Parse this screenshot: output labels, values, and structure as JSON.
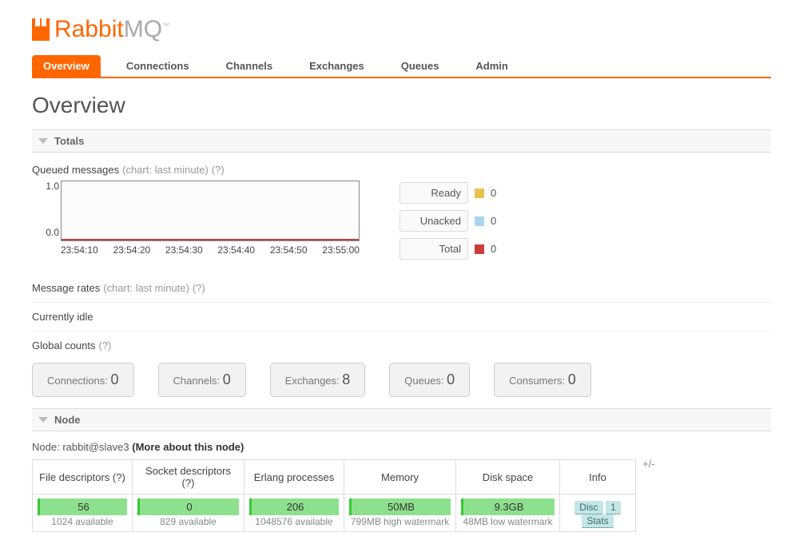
{
  "brand": {
    "name_a": "Rabbit",
    "name_b": "MQ"
  },
  "tabs": [
    "Overview",
    "Connections",
    "Channels",
    "Exchanges",
    "Queues",
    "Admin"
  ],
  "active_tab": 0,
  "page_title": "Overview",
  "sections": {
    "totals": "Totals",
    "node": "Node"
  },
  "queued": {
    "label": "Queued messages",
    "chart_hint": "(chart: last minute)",
    "help": "(?)"
  },
  "message_rates": {
    "label": "Message rates",
    "chart_hint": "(chart: last minute)",
    "help": "(?)",
    "status": "Currently idle"
  },
  "global_counts_label": "Global counts",
  "global_counts_help": "(?)",
  "chart_data": {
    "type": "line",
    "title": "Queued messages",
    "xlabel": "",
    "ylabel": "",
    "ylim": [
      0.0,
      1.0
    ],
    "y_ticks": [
      "1.0",
      "0.0"
    ],
    "x_ticks": [
      "23:54:10",
      "23:54:20",
      "23:54:30",
      "23:54:40",
      "23:54:50",
      "23:55:00"
    ],
    "series": [
      {
        "name": "Ready",
        "color": "#e6c24d",
        "values": [
          0,
          0,
          0,
          0,
          0,
          0
        ],
        "current": 0
      },
      {
        "name": "Unacked",
        "color": "#a8d6f0",
        "values": [
          0,
          0,
          0,
          0,
          0,
          0
        ],
        "current": 0
      },
      {
        "name": "Total",
        "color": "#cc3b3b",
        "values": [
          0,
          0,
          0,
          0,
          0,
          0
        ],
        "current": 0
      }
    ]
  },
  "counts": [
    {
      "label": "Connections:",
      "value": "0"
    },
    {
      "label": "Channels:",
      "value": "0"
    },
    {
      "label": "Exchanges:",
      "value": "8"
    },
    {
      "label": "Queues:",
      "value": "0"
    },
    {
      "label": "Consumers:",
      "value": "0"
    }
  ],
  "node": {
    "prefix": "Node:",
    "name": "rabbit@slave3",
    "more": "(More about this node)",
    "plusminus": "+/-",
    "headers": [
      "File descriptors (?)",
      "Socket descriptors (?)",
      "Erlang processes",
      "Memory",
      "Disk space",
      "Info"
    ],
    "cells": {
      "fd": {
        "val": "56",
        "sub": "1024 available"
      },
      "sd": {
        "val": "0",
        "sub": "829 available"
      },
      "ep": {
        "val": "206",
        "sub": "1048576 available"
      },
      "mem": {
        "val": "50MB",
        "sub": "799MB high watermark"
      },
      "disk": {
        "val": "9.3GB",
        "sub": "48MB low watermark"
      },
      "info": [
        "Disc",
        "1",
        "Stats"
      ]
    }
  }
}
